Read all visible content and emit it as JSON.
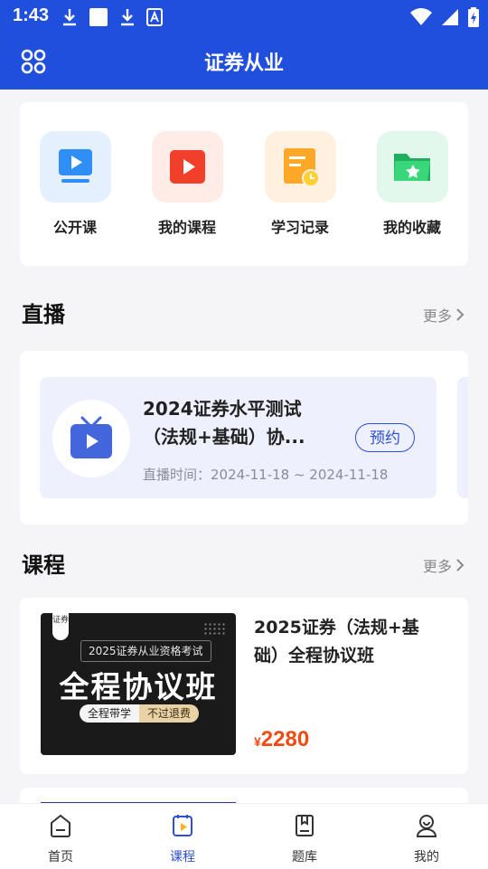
{
  "status_bar": {
    "time": "1:43"
  },
  "app_bar": {
    "title": "证券从业"
  },
  "quick_actions": [
    {
      "label": "公开课",
      "icon": "monitor-play-icon",
      "bg": "#e5f0ff",
      "color": "#2f8ff7"
    },
    {
      "label": "我的课程",
      "icon": "video-play-icon",
      "bg": "#ffece6",
      "color": "#f23f2a"
    },
    {
      "label": "学习记录",
      "icon": "note-clock-icon",
      "bg": "#fff0df",
      "color": "#ffa726"
    },
    {
      "label": "我的收藏",
      "icon": "folder-star-icon",
      "bg": "#e2f8ec",
      "color": "#2ecb70"
    }
  ],
  "live": {
    "section_title": "直播",
    "more_label": "更多",
    "item": {
      "title": "2024证券水平测试（法规+基础）协...",
      "time_label": "直播时间：",
      "time_range": "2024-11-18 ~ 2024-11-18",
      "book_label": "预约"
    }
  },
  "courses": {
    "section_title": "课程",
    "more_label": "更多",
    "item": {
      "title": "2025证券（法规+基础）全程协议班",
      "price_symbol": "¥",
      "price": "2280",
      "thumb": {
        "tag": "证券",
        "subtitle": "2025证券从业资格考试",
        "main": "全程协议班",
        "pill_left": "全程带学",
        "pill_right": "不过退费"
      }
    }
  },
  "tabs": [
    {
      "label": "首页",
      "icon": "home-icon",
      "active": false
    },
    {
      "label": "课程",
      "icon": "course-play-icon",
      "active": true
    },
    {
      "label": "题库",
      "icon": "question-bank-book-icon",
      "active": false
    },
    {
      "label": "我的",
      "icon": "profile-icon",
      "active": false
    }
  ],
  "colors": {
    "primary": "#1f4fdc",
    "accent": "#2b4fd6",
    "price": "#f24a12"
  }
}
